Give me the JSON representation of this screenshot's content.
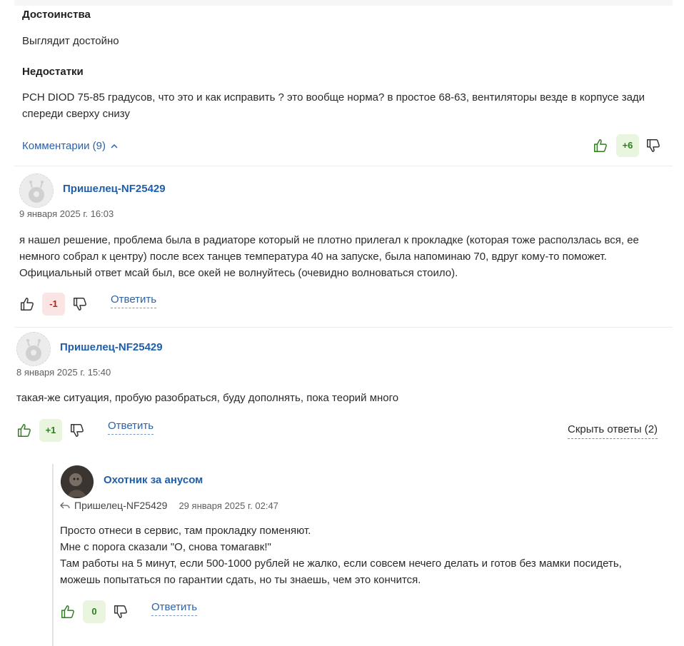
{
  "review": {
    "pros_heading": "Достоинства",
    "pros_text": "Выглядит достойно",
    "cons_heading": "Недостатки",
    "cons_line1": "PCH DIOD 75-85 градусов, что это и как исправить ? это вообще норма? в простое 68-63, вентиляторы везде в корпусе зади",
    "cons_line2": "спереди сверху снизу",
    "comments_toggle": "Комментарии (9)",
    "vote_score": "+6"
  },
  "comments": [
    {
      "author": "Пришелец-NF25429",
      "date": "9 января 2025 г. 16:03",
      "lines": [
        "я нашел решение, проблема была в радиаторе который не плотно прилегал к прокладке (которая тоже расползлась вся, ее",
        "немного собрал к центру) после всех танцев температура 40 на запуске, была напоминаю 70, вдруг кому-то поможет.",
        "Официальный ответ мсай был, все окей не волнуйтесь (очевидно волноваться стоило)."
      ],
      "score": "-1",
      "reply_label": "Ответить"
    },
    {
      "author": "Пришелец-NF25429",
      "date": "8 января 2025 г. 15:40",
      "lines": [
        "такая-же ситуация, пробую разобраться, буду дополнять, пока теорий много"
      ],
      "score": "+1",
      "reply_label": "Ответить",
      "hide_replies_label": "Скрыть ответы (2)"
    }
  ],
  "nested_reply": {
    "author": "Охотник за анусом",
    "reply_to": "Пришелец-NF25429",
    "date": "29 января 2025 г. 02:47",
    "lines": [
      "Просто отнеси в сервис, там прокладку поменяют.",
      "Мне с порога сказали \"О, снова томагавк!\"",
      "Там работы на 5 минут, если 500-1000 рублей не жалко, если совсем нечего делать и готов без мамки посидеть,",
      "можешь попытаться по гарантии сдать, но ты знаешь, чем это кончится."
    ],
    "score": "0",
    "reply_label": "Ответить"
  },
  "colors": {
    "link": "#2c62a8",
    "author": "#1f5ea8",
    "positive": "#2f7d1e",
    "negative": "#b51f1f"
  },
  "icons": {
    "like": "thumbs-up-icon",
    "dislike": "thumbs-down-icon",
    "chevron": "chevron-up-icon",
    "reply_arrow": "reply-arrow-icon"
  }
}
